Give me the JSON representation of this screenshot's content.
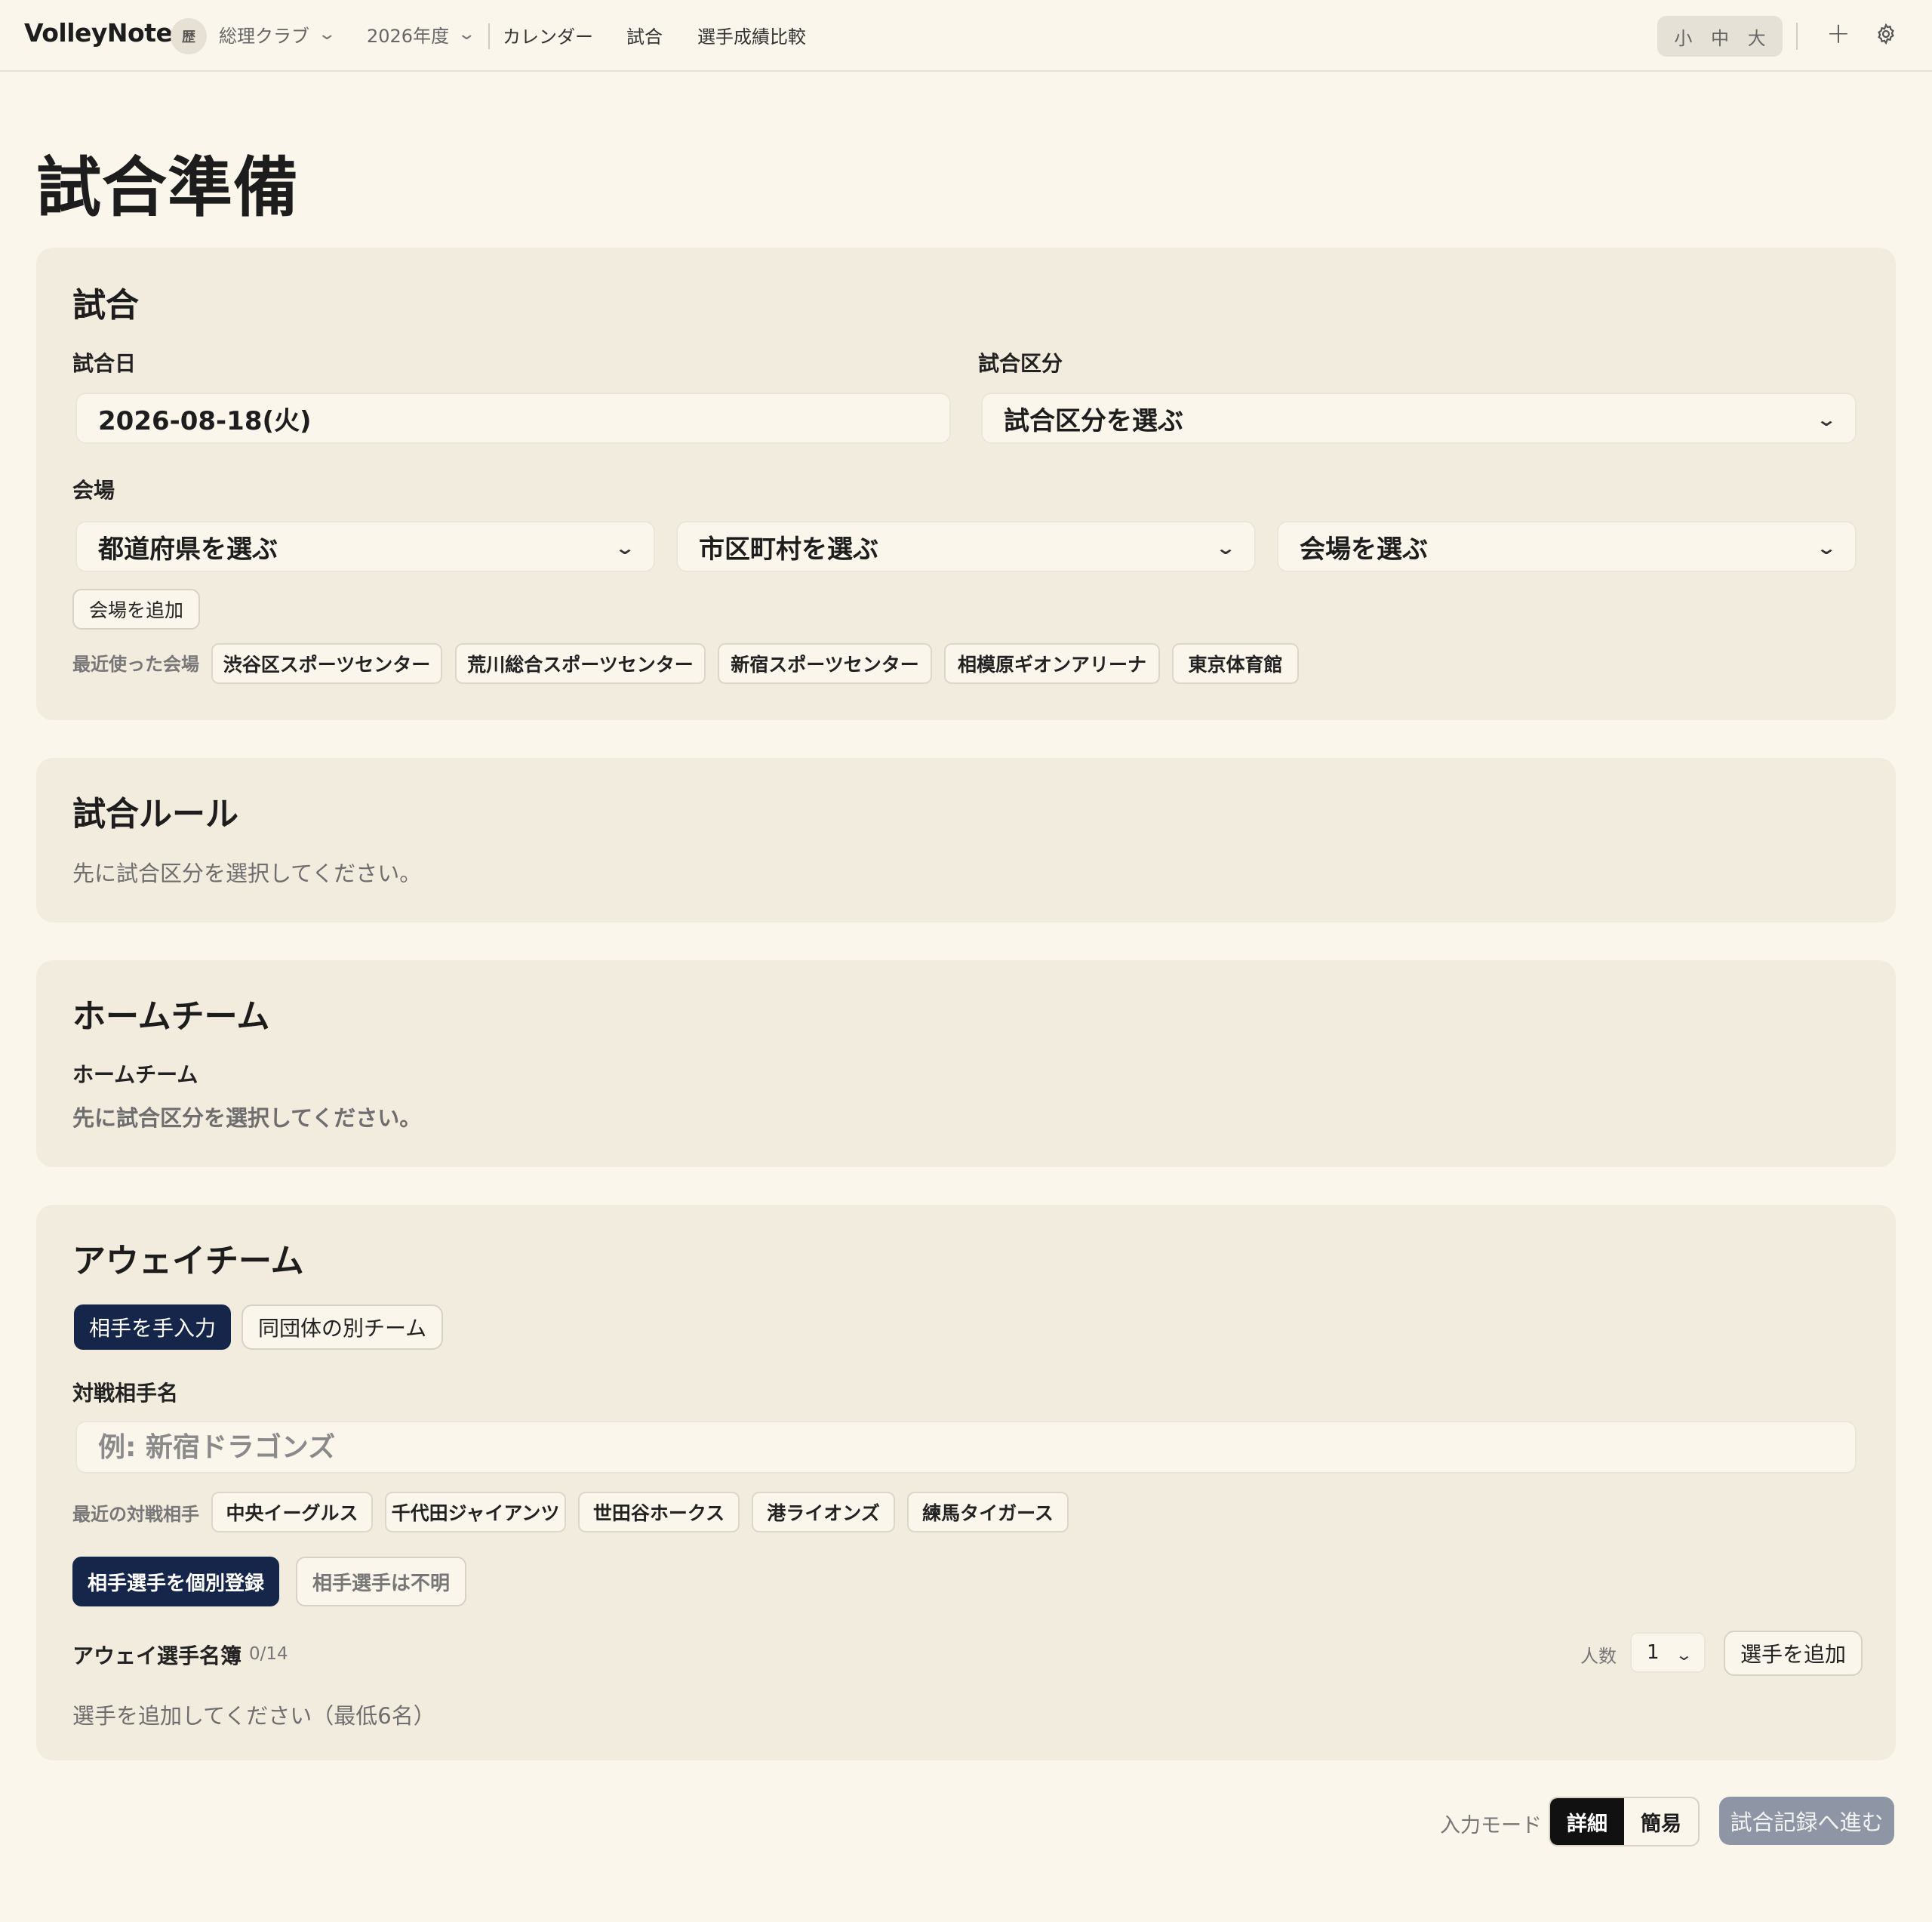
{
  "nav": {
    "brand": "VolleyNote",
    "club_avatar": "歴",
    "club": "総理クラブ",
    "season": "2026年度",
    "links": [
      "カレンダー",
      "試合",
      "選手成績比較"
    ],
    "font_sizes": [
      "小",
      "中",
      "大"
    ],
    "icons": [
      "chevron-down-icon",
      "plus-icon",
      "gear-icon"
    ]
  },
  "page": {
    "title": "試合準備"
  },
  "match": {
    "heading": "試合",
    "date_label": "試合日",
    "date_value": "2026-08-18(火)",
    "type_label": "試合区分",
    "type_placeholder": "試合区分を選ぶ",
    "venue_label": "会場",
    "prefecture_placeholder": "都道府県を選ぶ",
    "city_placeholder": "市区町村を選ぶ",
    "venue_placeholder": "会場を選ぶ",
    "add_venue": "会場を追加",
    "recent_label": "最近使った会場",
    "recent_venues": [
      "渋谷区スポーツセンター",
      "荒川総合スポーツセンター",
      "新宿スポーツセンター",
      "相模原ギオンアリーナ",
      "東京体育館"
    ]
  },
  "rules": {
    "heading": "試合ルール",
    "help": "先に試合区分を選択してください。"
  },
  "home": {
    "heading": "ホームチーム",
    "label": "ホームチーム",
    "help": "先に試合区分を選択してください。"
  },
  "away": {
    "heading": "アウェイチーム",
    "mode_manual": "相手を手入力",
    "mode_same_org": "同団体の別チーム",
    "opponent_label": "対戦相手名",
    "opponent_placeholder": "例: 新宿ドラゴンズ",
    "recent_label": "最近の対戦相手",
    "recent_opponents": [
      "中央イーグルス",
      "千代田ジャイアンツ",
      "世田谷ホークス",
      "港ライオンズ",
      "練馬タイガース"
    ],
    "register_players": "相手選手を個別登録",
    "players_unknown": "相手選手は不明",
    "roster_label": "アウェイ選手名簿",
    "roster_count": "0/14",
    "count_label": "人数",
    "count_value": "1",
    "add_player": "選手を追加",
    "roster_help": "選手を追加してください（最低6名）"
  },
  "footer": {
    "mode_label": "入力モード",
    "mode_detail": "詳細",
    "mode_simple": "簡易",
    "proceed": "試合記録へ進む"
  },
  "colors": {
    "background": "#faf6ec",
    "card": "#f2ecdf",
    "primary_dark": "#16264a",
    "disabled_button": "#8e96a6"
  }
}
